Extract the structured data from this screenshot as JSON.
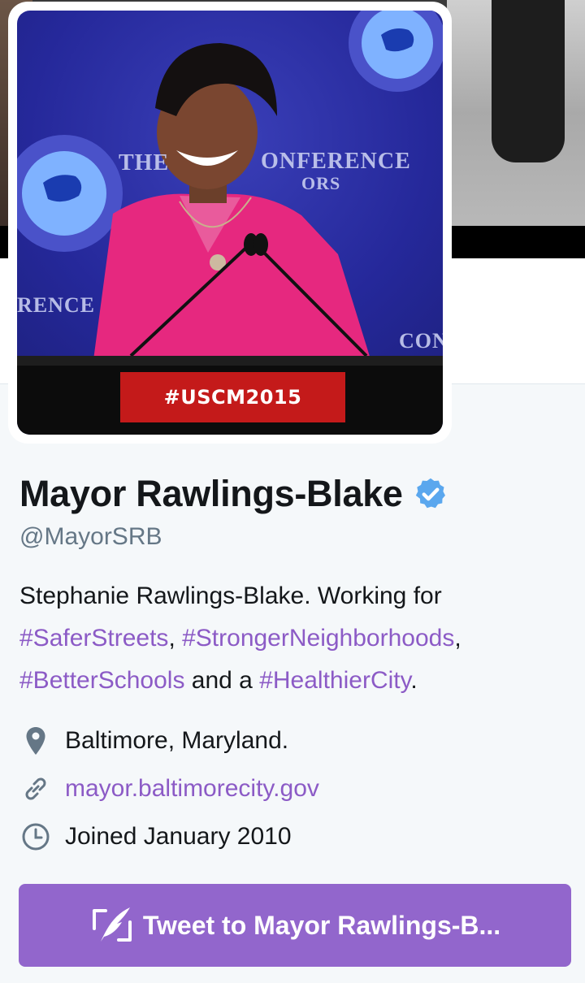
{
  "avatar": {
    "podium_label": "#USCM2015",
    "backdrop_text_1": "THE",
    "backdrop_text_2": "ONFERENCE",
    "backdrop_text_3": "ORS",
    "backdrop_text_4": "RENCE",
    "backdrop_text_5": "CONF"
  },
  "profile": {
    "name": "Mayor Rawlings-Blake",
    "verified": true,
    "handle": "@MayorSRB",
    "bio": {
      "line1": "Stephanie Rawlings-Blake. Working for",
      "tag1": "#SaferStreets",
      "sep1": ", ",
      "tag2": "#StrongerNeighborhoods",
      "sep2": ",",
      "tag3": "#BetterSchools",
      "mid": " and a ",
      "tag4": "#HealthierCity",
      "end": "."
    },
    "location": "Baltimore, Maryland.",
    "website": "mayor.baltimorecity.gov",
    "joined": "Joined January 2010"
  },
  "actions": {
    "tweet_to_label": "Tweet to Mayor Rawlings-B..."
  },
  "colors": {
    "link": "#8c5bc6",
    "button_bg": "#9266cc",
    "verified": "#1da1f2",
    "secondary_text": "#657786"
  },
  "icons": {
    "verified": "verified-badge-icon",
    "location": "location-pin-icon",
    "link": "link-icon",
    "joined": "calendar-clock-icon",
    "compose": "compose-tweet-icon"
  }
}
